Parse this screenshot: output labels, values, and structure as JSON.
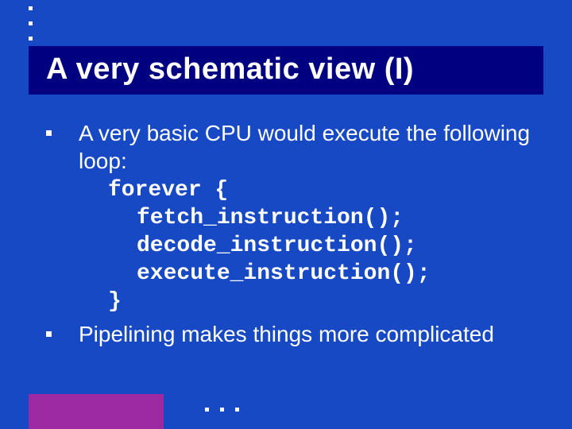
{
  "slide": {
    "title": "A very schematic view (I)",
    "bullets": [
      {
        "text": "A very basic CPU would execute the following loop:",
        "code": [
          "forever {",
          "  fetch_instruction();",
          "  decode_instruction();",
          "  execute_instruction();",
          "}"
        ]
      },
      {
        "text": "Pipelining  makes  things more complicated"
      }
    ]
  }
}
